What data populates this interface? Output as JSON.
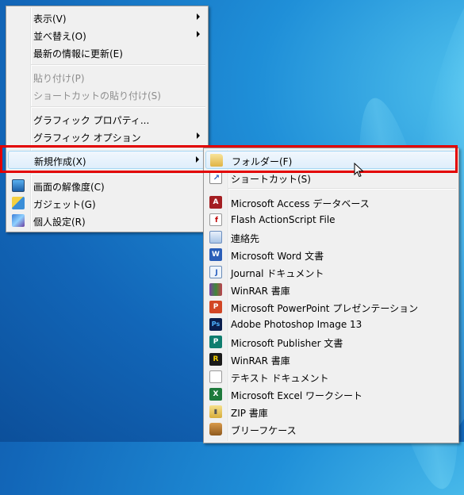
{
  "desktop_menu": {
    "items": [
      {
        "label": "表示(V)",
        "submenu": true
      },
      {
        "label": "並べ替え(O)",
        "submenu": true
      },
      {
        "label": "最新の情報に更新(E)"
      },
      {
        "label": "貼り付け(P)",
        "disabled": true
      },
      {
        "label": "ショートカットの貼り付け(S)",
        "disabled": true
      },
      {
        "label": "グラフィック プロパティ..."
      },
      {
        "label": "グラフィック オプション",
        "submenu": true
      },
      {
        "label": "新規作成(X)",
        "submenu": true,
        "highlighted": true
      },
      {
        "label": "画面の解像度(C)",
        "icon": "monitor-icon"
      },
      {
        "label": "ガジェット(G)",
        "icon": "gadget-icon"
      },
      {
        "label": "個人設定(R)",
        "icon": "personalize-icon"
      }
    ]
  },
  "new_submenu": {
    "items": [
      {
        "label": "フォルダー(F)",
        "icon": "folder-icon",
        "highlighted": true
      },
      {
        "label": "ショートカット(S)",
        "icon": "shortcut-icon"
      },
      {
        "label": "Microsoft Access データベース",
        "icon": "access-icon"
      },
      {
        "label": "Flash ActionScript File",
        "icon": "flash-file-icon"
      },
      {
        "label": "連絡先",
        "icon": "contact-icon"
      },
      {
        "label": "Microsoft Word 文書",
        "icon": "word-icon"
      },
      {
        "label": "Journal ドキュメント",
        "icon": "journal-icon"
      },
      {
        "label": "WinRAR 書庫",
        "icon": "winrar-icon"
      },
      {
        "label": "Microsoft PowerPoint プレゼンテーション",
        "icon": "powerpoint-icon"
      },
      {
        "label": "Adobe Photoshop Image 13",
        "icon": "photoshop-icon"
      },
      {
        "label": "Microsoft Publisher 文書",
        "icon": "publisher-icon"
      },
      {
        "label": "WinRAR 書庫",
        "icon": "winrar-r-icon"
      },
      {
        "label": "テキスト ドキュメント",
        "icon": "text-document-icon"
      },
      {
        "label": "Microsoft Excel ワークシート",
        "icon": "excel-icon"
      },
      {
        "label": "ZIP 書庫",
        "icon": "zip-icon"
      },
      {
        "label": "ブリーフケース",
        "icon": "briefcase-icon"
      }
    ]
  },
  "colors": {
    "annotation_frame": "#e30000",
    "menu_bg": "#f0f0f0",
    "desktop": "#1a78c8"
  }
}
